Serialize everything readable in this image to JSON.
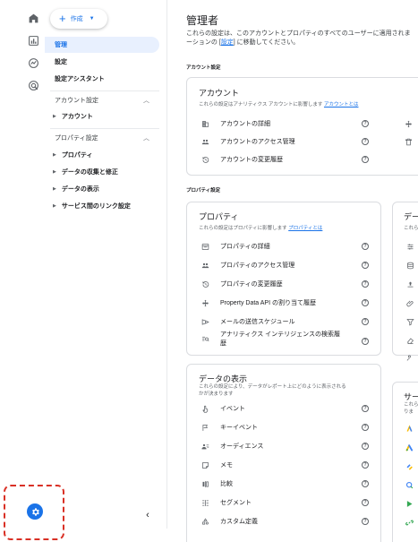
{
  "sidebar": {
    "create_label": "作成",
    "items": [
      {
        "label": "管理",
        "active": true
      },
      {
        "label": "設定"
      },
      {
        "label": "設定アシスタント"
      }
    ],
    "account_section": "アカウント設定",
    "account_items": [
      {
        "label": "アカウント"
      }
    ],
    "property_section": "プロパティ設定",
    "property_items": [
      {
        "label": "プロパティ"
      },
      {
        "label": "データの収集と修正"
      },
      {
        "label": "データの表示"
      },
      {
        "label": "サービス間のリンク設定"
      }
    ]
  },
  "header": {
    "title": "管理者",
    "desc_line1": "これらの設定は、このアカウントとプロパティのすべてのユーザーに適用されま",
    "desc_line2_pre": "ーションの [",
    "desc_line2_link": "設定",
    "desc_line2_post": "] に移動してください。"
  },
  "account_settings_label": "アカウント設定",
  "account_card": {
    "title": "アカウント",
    "subtitle": "これらの設定はアナリティクス アカウントに影響します",
    "link": "アカウントとは",
    "rows": [
      {
        "label": "アカウントの詳細"
      },
      {
        "label": "アカウントのアクセス管理"
      },
      {
        "label": "アカウントの変更履歴"
      }
    ]
  },
  "property_settings_label": "プロパティ設定",
  "property_card": {
    "title": "プロパティ",
    "subtitle": "これらの設定はプロパティに影響します",
    "link": "プロパティとは",
    "rows": [
      {
        "label": "プロパティの詳細"
      },
      {
        "label": "プロパティのアクセス管理"
      },
      {
        "label": "プロパティの変更履歴"
      },
      {
        "label": "Property Data API の割り当て履歴"
      },
      {
        "label": "メールの送信スケジュール"
      },
      {
        "label": "アナリティクス インテリジェンスの検索履"
      },
      {
        "label": "歴"
      }
    ]
  },
  "data_card_partial": {
    "title": "デー",
    "subtitle": "これら"
  },
  "display_card": {
    "title": "データの表示",
    "subtitle_line1": "これらの設定により、データがレポート上にどのように表示される",
    "subtitle_line2": "かが決まります",
    "rows": [
      {
        "label": "イベント"
      },
      {
        "label": "キーイベント"
      },
      {
        "label": "オーディエンス"
      },
      {
        "label": "メモ"
      },
      {
        "label": "比較"
      },
      {
        "label": "セグメント"
      },
      {
        "label": "カスタム定義"
      }
    ]
  },
  "service_card_partial": {
    "title": "サー",
    "subtitle_line1": "これら",
    "subtitle_line2": "りま"
  },
  "help_glyph": "?"
}
